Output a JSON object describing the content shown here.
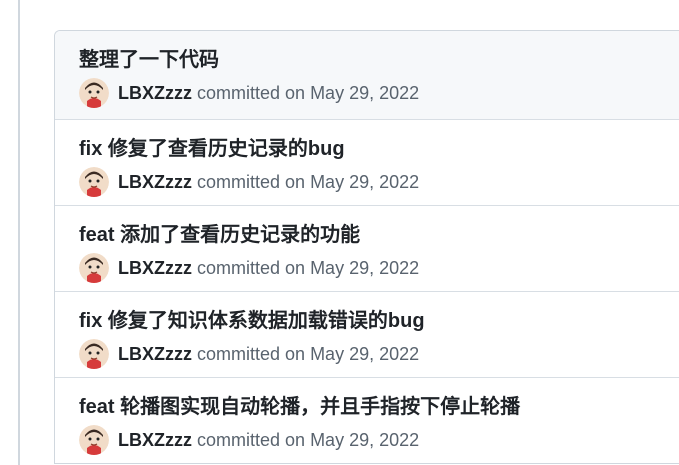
{
  "commits": [
    {
      "message": "整理了一下代码",
      "author": "LBXZzzz",
      "action": "committed",
      "on": "on",
      "date": "May 29, 2022"
    },
    {
      "message": "fix 修复了查看历史记录的bug",
      "author": "LBXZzzz",
      "action": "committed",
      "on": "on",
      "date": "May 29, 2022"
    },
    {
      "message": "feat 添加了查看历史记录的功能",
      "author": "LBXZzzz",
      "action": "committed",
      "on": "on",
      "date": "May 29, 2022"
    },
    {
      "message": "fix 修复了知识体系数据加载错误的bug",
      "author": "LBXZzzz",
      "action": "committed",
      "on": "on",
      "date": "May 29, 2022"
    },
    {
      "message": "feat 轮播图实现自动轮播，并且手指按下停止轮播",
      "author": "LBXZzzz",
      "action": "committed",
      "on": "on",
      "date": "May 29, 2022"
    }
  ],
  "colors": {
    "border": "#d0d7de",
    "muted_text": "#59636e",
    "header_bg": "#f6f8fa"
  }
}
